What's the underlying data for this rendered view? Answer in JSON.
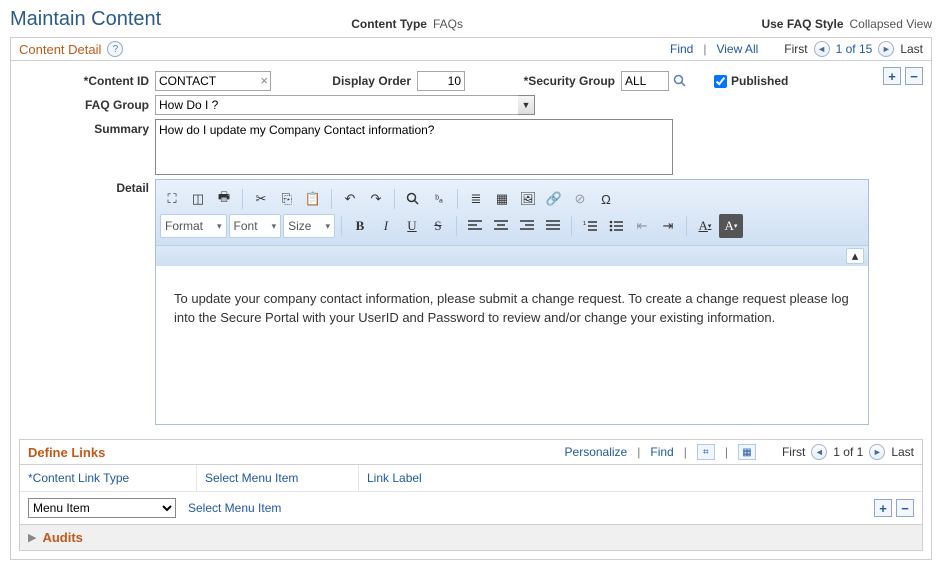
{
  "header": {
    "page_title": "Maintain Content",
    "content_type_label": "Content Type",
    "content_type_value": "FAQs",
    "faq_style_label": "Use FAQ Style",
    "faq_style_value": "Collapsed View"
  },
  "content_detail": {
    "title": "Content Detail",
    "nav": {
      "find": "Find",
      "view_all": "View All",
      "first": "First",
      "position": "1 of 15",
      "last": "Last"
    },
    "fields": {
      "content_id_label": "*Content ID",
      "content_id_value": "CONTACT",
      "display_order_label": "Display Order",
      "display_order_value": "10",
      "security_group_label": "*Security Group",
      "security_group_value": "ALL",
      "published_label": "Published",
      "published_checked": true,
      "faq_group_label": "FAQ Group",
      "faq_group_value": "How Do I ?",
      "summary_label": "Summary",
      "summary_value": "How do I update my Company Contact information?",
      "detail_label": "Detail"
    }
  },
  "rte": {
    "format": "Format",
    "font": "Font",
    "size": "Size",
    "content": "To update your company contact information, please submit a change request.  To create a change request please log into the Secure Portal with your UserID and Password to review and/or change your existing information."
  },
  "define_links": {
    "title": "Define Links",
    "personalize": "Personalize",
    "find": "Find",
    "nav": {
      "first": "First",
      "position": "1 of 1",
      "last": "Last"
    },
    "columns": {
      "content_link_type": "*Content Link Type",
      "select_menu_item": "Select Menu Item",
      "link_label": "Link Label"
    },
    "row": {
      "content_link_type_value": "Menu Item",
      "select_menu_item_link": "Select Menu Item"
    }
  },
  "audits": {
    "title": "Audits"
  }
}
